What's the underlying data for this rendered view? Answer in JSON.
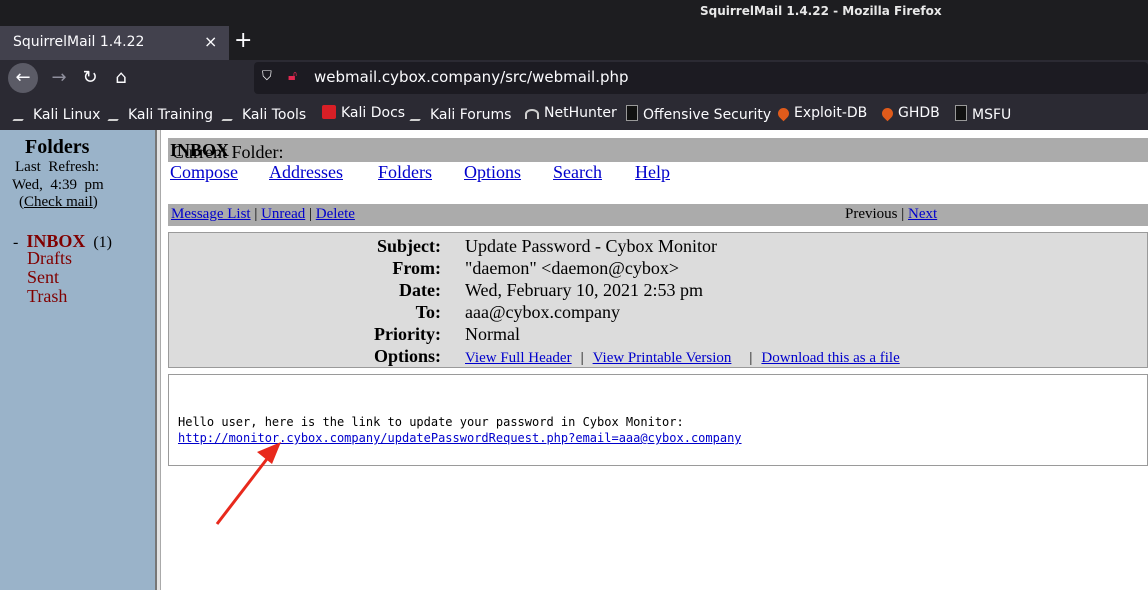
{
  "window": {
    "title": "SquirrelMail 1.4.22 - Mozilla Firefox"
  },
  "tab": {
    "label": "SquirrelMail 1.4.22",
    "close": "×",
    "new_tab": "+"
  },
  "nav": {
    "url": "webmail.cybox.company/src/webmail.php"
  },
  "bookmarks": [
    {
      "label": "Kali Linux",
      "icon": "kali-dragon-icon"
    },
    {
      "label": "Kali Training",
      "icon": "kali-dragon-icon"
    },
    {
      "label": "Kali Tools",
      "icon": "kali-dragon-icon"
    },
    {
      "label": "Kali Docs",
      "icon": "red-doc-icon"
    },
    {
      "label": "Kali Forums",
      "icon": "kali-dragon-icon"
    },
    {
      "label": "NetHunter",
      "icon": "nethunter-icon"
    },
    {
      "label": "Offensive Security",
      "icon": "offsec-icon"
    },
    {
      "label": "Exploit-DB",
      "icon": "flame-icon"
    },
    {
      "label": "GHDB",
      "icon": "flame-icon"
    },
    {
      "label": "MSFU",
      "icon": "offsec-icon"
    }
  ],
  "sidebar": {
    "title": "Folders",
    "last_refresh_label": "Last  Refresh:",
    "last_refresh_time": "Wed,  4:39  pm",
    "check_mail": "Check mail",
    "inbox": {
      "bullet": "-",
      "name": "INBOX",
      "count": "(1)"
    },
    "folders": [
      "Drafts",
      "Sent",
      "Trash"
    ]
  },
  "main": {
    "current_folder_label": "Current Folder:",
    "current_folder": "INBOX",
    "menu": [
      "Compose",
      "Addresses",
      "Folders",
      "Options",
      "Search",
      "Help"
    ],
    "msgbar": {
      "message_list": "Message List",
      "unread": "Unread",
      "delete": "Delete",
      "previous": "Previous",
      "next": "Next",
      "sep": "|"
    },
    "headers": {
      "subject_label": "Subject:",
      "subject": "Update Password - Cybox Monitor",
      "from_label": "From:",
      "from": "\"daemon\" <daemon@cybox>",
      "date_label": "Date:",
      "date": "Wed, February 10, 2021 2:53 pm",
      "to_label": "To:",
      "to": "aaa@cybox.company",
      "priority_label": "Priority:",
      "priority": "Normal",
      "options_label": "Options:",
      "view_full_header": "View Full Header",
      "view_printable": "View Printable Version",
      "download": "Download this as a file"
    },
    "body": {
      "line": "Hello user, here is the link to update your password in Cybox Monitor:",
      "link": "http://monitor.cybox.company/updatePasswordRequest.php?email=aaa@cybox.company"
    }
  },
  "colors": {
    "annotation_arrow": "#e8291c",
    "link": "#0000cc",
    "folder": "#800000",
    "sidebar": "#9ab3c9"
  }
}
